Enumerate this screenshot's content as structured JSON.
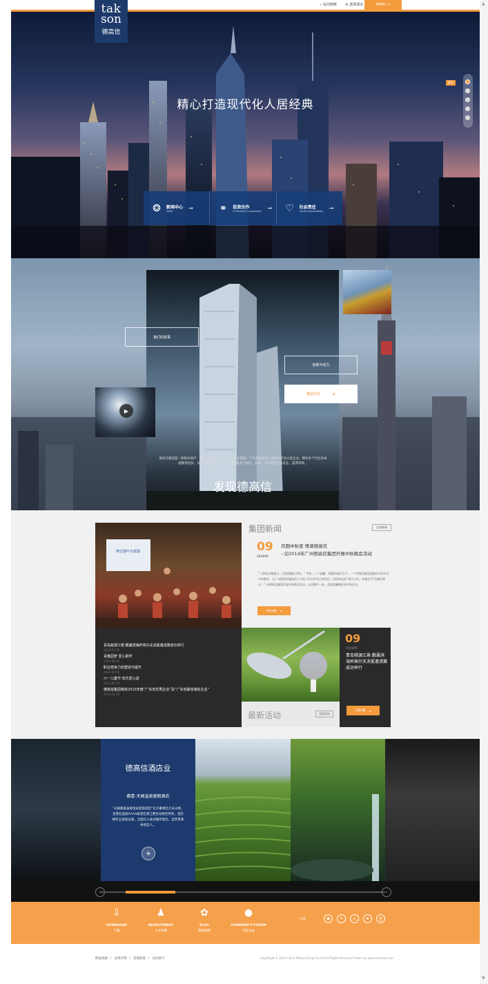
{
  "topbar": {
    "search_label": "站内搜索",
    "lang_label": "选择语言",
    "menu_label": "MENU"
  },
  "logo": {
    "line1": "tak",
    "line2": "son",
    "cn": "德高信"
  },
  "hero": {
    "title": "精心打造现代化人居经典",
    "nav": [
      {
        "icon": "❂",
        "cn": "新闻中心",
        "en": "News"
      },
      {
        "icon": "⚭",
        "cn": "投资合作",
        "en": "Investment cooperation"
      },
      {
        "icon": "♡",
        "cn": "社会责任",
        "en": "Social responsibility"
      }
    ],
    "slide_tip": "首页"
  },
  "discover": {
    "link_story": "我们的故事",
    "link_power": "创新与动力",
    "culture_btn": "集团文化",
    "desc": "德高信集团是一家集房地产、酒店、旅游、生态农业、物业管理、广告策划等为一体的多元化大型企业，拥有多个行业的卓越精英团队，员工总数超过5000人，运营着多个酒店、商场、写字楼及生态农业、旅游项目。",
    "title": "发现德高信"
  },
  "news": {
    "heading": "集团新闻",
    "more": "全部新闻",
    "photo_screen_text": "穿过落叶与孤独",
    "day": "09",
    "month": "2014/09",
    "title_line1": "月圆中秋夜 情满德高信",
    "title_line2": "--记2014年广州德高信集团开展中秋晚会活动",
    "body": "“八是桂岁最难分，又是团圆在中秋。” 中秋，一个温馨、团圆的美好日子，一个传统的象征团圆欢乐的节日中秋晚会、让广州德高信集团员工与家人们分享节日的快乐，深切体会到“快乐工作、幸福生活”的美好意义，广州德高信集团开展中秋晚会活动，让同事们一起，共度温馨美好的中秋佳节。",
    "read_more": "了解详情",
    "list": [
      {
        "title": "青岛桃源江景:鹏瀛滨海杯高尔夫消夏邀请赛成功举行",
        "date": "2014-07-15"
      },
      {
        "title": "青春园梦 爱心助学",
        "date": "2014-06-26"
      },
      {
        "title": "职业竞争力的塑造与提升",
        "date": "2014-06-06"
      },
      {
        "title": "六一儿童节 欢乐爱心送",
        "date": "2014-05-30"
      },
      {
        "title": "德高信集团荣获2013年度“广东省优秀企业”及“广东省最佳诚信企业”",
        "date": "2013-12-16"
      }
    ]
  },
  "activity": {
    "heading": "最新活动",
    "more": "全部活动",
    "day": "09",
    "month": "2014/09",
    "text": "青岛桃源江景:鹏瀛滨海杯高尔夫消夏邀请赛成功举行",
    "read_more": "了解详情"
  },
  "hotel": {
    "title": "德高信酒店业",
    "subtitle": "都喜·天阙温泉度假酒店",
    "desc": "“天阙都喜泰黎温泉度假酒店”位于番禺区大夫山侧，坐落在国家AAAA级景区香江野生动物世界旁，酒店拥有五星级设施，全面引入泰式服务理念，自然景观秀丽宜人。"
  },
  "footer": {
    "items": [
      {
        "icon": "⇩",
        "en": "DOWNLOAD",
        "cn": "下载"
      },
      {
        "icon": "♟",
        "en": "RECRUITMENT",
        "cn": "人才招聘"
      },
      {
        "icon": "✿",
        "en": "BLOG",
        "cn": "德高微博"
      },
      {
        "icon": "●",
        "en": "COMMUNITY FORUM",
        "cn": "社区论坛"
      }
    ],
    "share_label": "分享",
    "share_icons": [
      "weibo",
      "tencent-weibo",
      "renren",
      "qzone",
      "douban"
    ]
  },
  "bottom": {
    "links": [
      "网站地图",
      "法律声明",
      "友情链接",
      "访问统计"
    ],
    "copyright": "CopyRight © 2014 China Takson Group Co.,Ltd All Rights Reserved. Power by www.sanzhao.com"
  },
  "colors": {
    "accent": "#f39b3d",
    "navy": "#1c3a6e",
    "dark": "#2a2a2a"
  }
}
